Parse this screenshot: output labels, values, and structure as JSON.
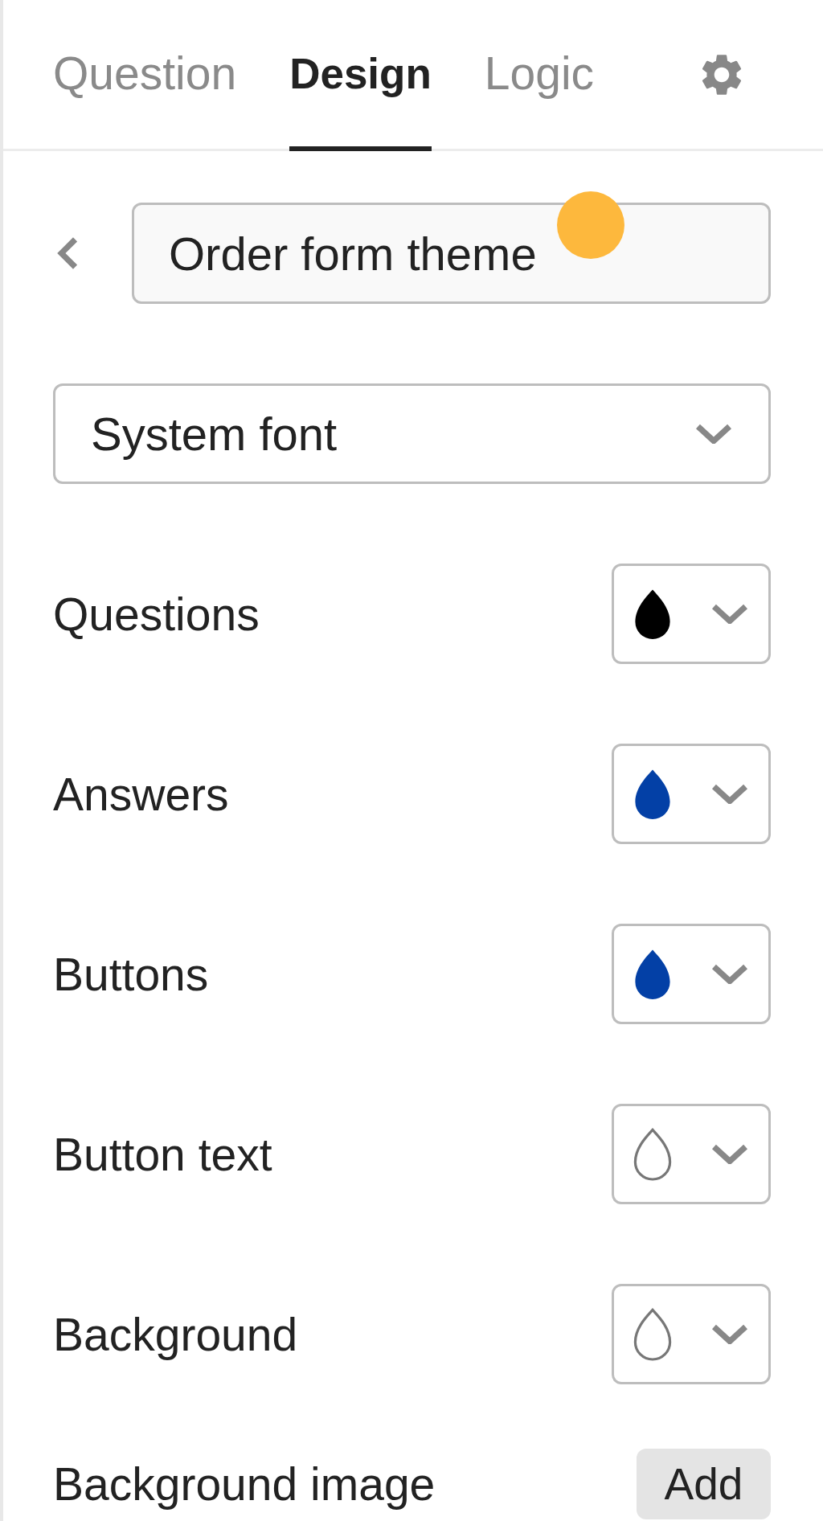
{
  "tabs": [
    {
      "label": "Question",
      "selected": false
    },
    {
      "label": "Design",
      "selected": true
    },
    {
      "label": "Logic",
      "selected": false
    }
  ],
  "theme_name": {
    "value": "Order form theme"
  },
  "font_select": {
    "value": "System font"
  },
  "color_settings": [
    {
      "label": "Questions",
      "kind": "filled",
      "color": "#000000"
    },
    {
      "label": "Answers",
      "kind": "filled",
      "color": "#0340a6"
    },
    {
      "label": "Buttons",
      "kind": "filled",
      "color": "#0340a6"
    },
    {
      "label": "Button text",
      "kind": "outline"
    },
    {
      "label": "Background",
      "kind": "outline"
    }
  ],
  "background_image": {
    "label": "Background image",
    "button": "Add"
  }
}
